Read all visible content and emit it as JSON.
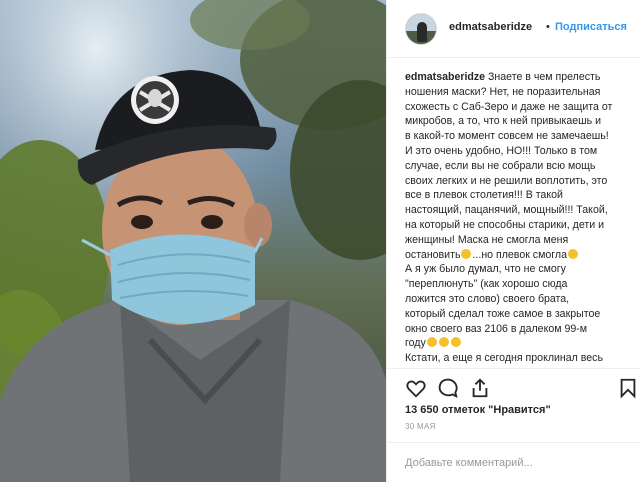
{
  "post": {
    "username": "edmatsaberidze",
    "separator": "•",
    "follow_label": "Подписаться",
    "caption_lines": [
      "Знаете в чем прелесть",
      "ношения маски? Нет, не поразительная",
      "схожесть с Саб-Зеро и даже не защита от",
      "микробов, а то, что к ней привыкаешь и",
      "в какой-то момент совсем не замечаешь!",
      "И это очень удобно, НО!!! Только в том",
      "случае, если вы не собрали всю мощь",
      "своих легких и не решили воплотить, это",
      "все в плевок столетия!!! В такой",
      "настоящий, пацанячий, мощный!!! Такой,",
      "на который не способны старики, дети и",
      "женщины! Маска не смогла меня",
      "остановить",
      "...но плевок смогла",
      "А я уж было думал, что не смогу",
      "\"переплюнуть\" (как хорошо сюда",
      "ложится это слово) своего брата,",
      "который сделал тоже самое в закрытое",
      "окно своего ваз 2106 в далеком 99-м",
      "году",
      "Кстати, а еще я сегодня проклинал весь"
    ],
    "likes": "13 650 отметок \"Нравится\"",
    "date": "30 МАЯ",
    "comment_placeholder": "Добавьте комментарий..."
  },
  "icons": {
    "like": "heart-icon",
    "comment": "comment-icon",
    "share": "share-icon",
    "save": "bookmark-icon",
    "cap_logo": "raiders-logo"
  },
  "colors": {
    "link": "#3897f0",
    "text": "#262626",
    "muted": "#999999",
    "border": "#efefef",
    "emoji": "#f5c02a"
  }
}
